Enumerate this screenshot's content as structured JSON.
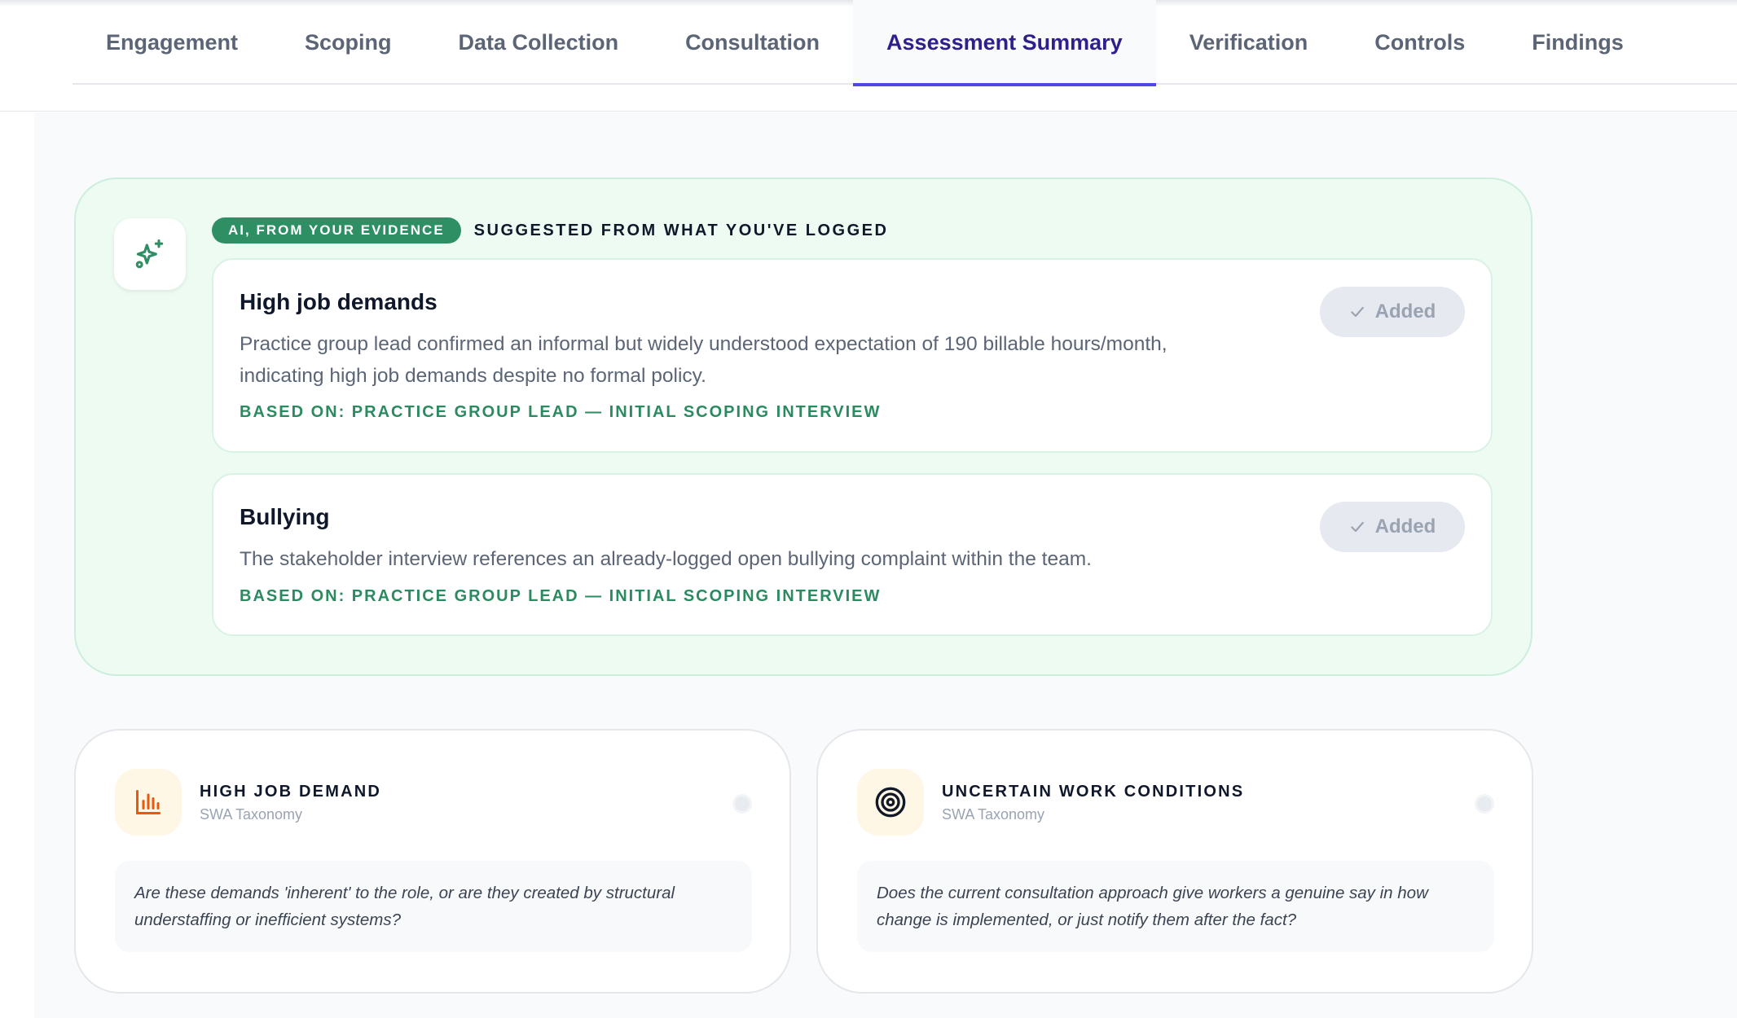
{
  "tabs": [
    {
      "label": "Engagement",
      "active": false
    },
    {
      "label": "Scoping",
      "active": false
    },
    {
      "label": "Data Collection",
      "active": false
    },
    {
      "label": "Consultation",
      "active": false
    },
    {
      "label": "Assessment Summary",
      "active": true
    },
    {
      "label": "Verification",
      "active": false
    },
    {
      "label": "Controls",
      "active": false
    },
    {
      "label": "Findings",
      "active": false
    }
  ],
  "ai_panel": {
    "icon": "sparkles-icon",
    "badge": "AI, FROM YOUR EVIDENCE",
    "heading": "SUGGESTED FROM WHAT YOU'VE LOGGED",
    "suggestions": [
      {
        "title": "High job demands",
        "description": "Practice group lead confirmed an informal but widely understood expectation of 190 billable hours/month, indicating high job demands despite no formal policy.",
        "basis": "BASED ON: PRACTICE GROUP LEAD — INITIAL SCOPING INTERVIEW",
        "button_label": "Added",
        "button_icon": "check-icon"
      },
      {
        "title": "Bullying",
        "description": "The stakeholder interview references an already-logged open bullying complaint within the team.",
        "basis": "BASED ON: PRACTICE GROUP LEAD — INITIAL SCOPING INTERVIEW",
        "button_label": "Added",
        "button_icon": "check-icon"
      }
    ]
  },
  "categories": [
    {
      "title": "HIGH JOB DEMAND",
      "subtitle": "SWA Taxonomy",
      "icon": "bar-chart-icon",
      "icon_color": "#ea580c",
      "question": "Are these demands 'inherent' to the role, or are they created by structural understaffing or inefficient systems?"
    },
    {
      "title": "UNCERTAIN WORK CONDITIONS",
      "subtitle": "SWA Taxonomy",
      "icon": "target-icon",
      "icon_color": "#111827",
      "question": "Does the current consultation approach give workers a genuine say in how change is implemented, or just notify them after the fact?"
    }
  ],
  "colors": {
    "accent": "#4f46e5",
    "active_tab_text": "#2e1f8c",
    "ai_green": "#2f8f64",
    "ai_panel_bg": "#edfbf3"
  }
}
